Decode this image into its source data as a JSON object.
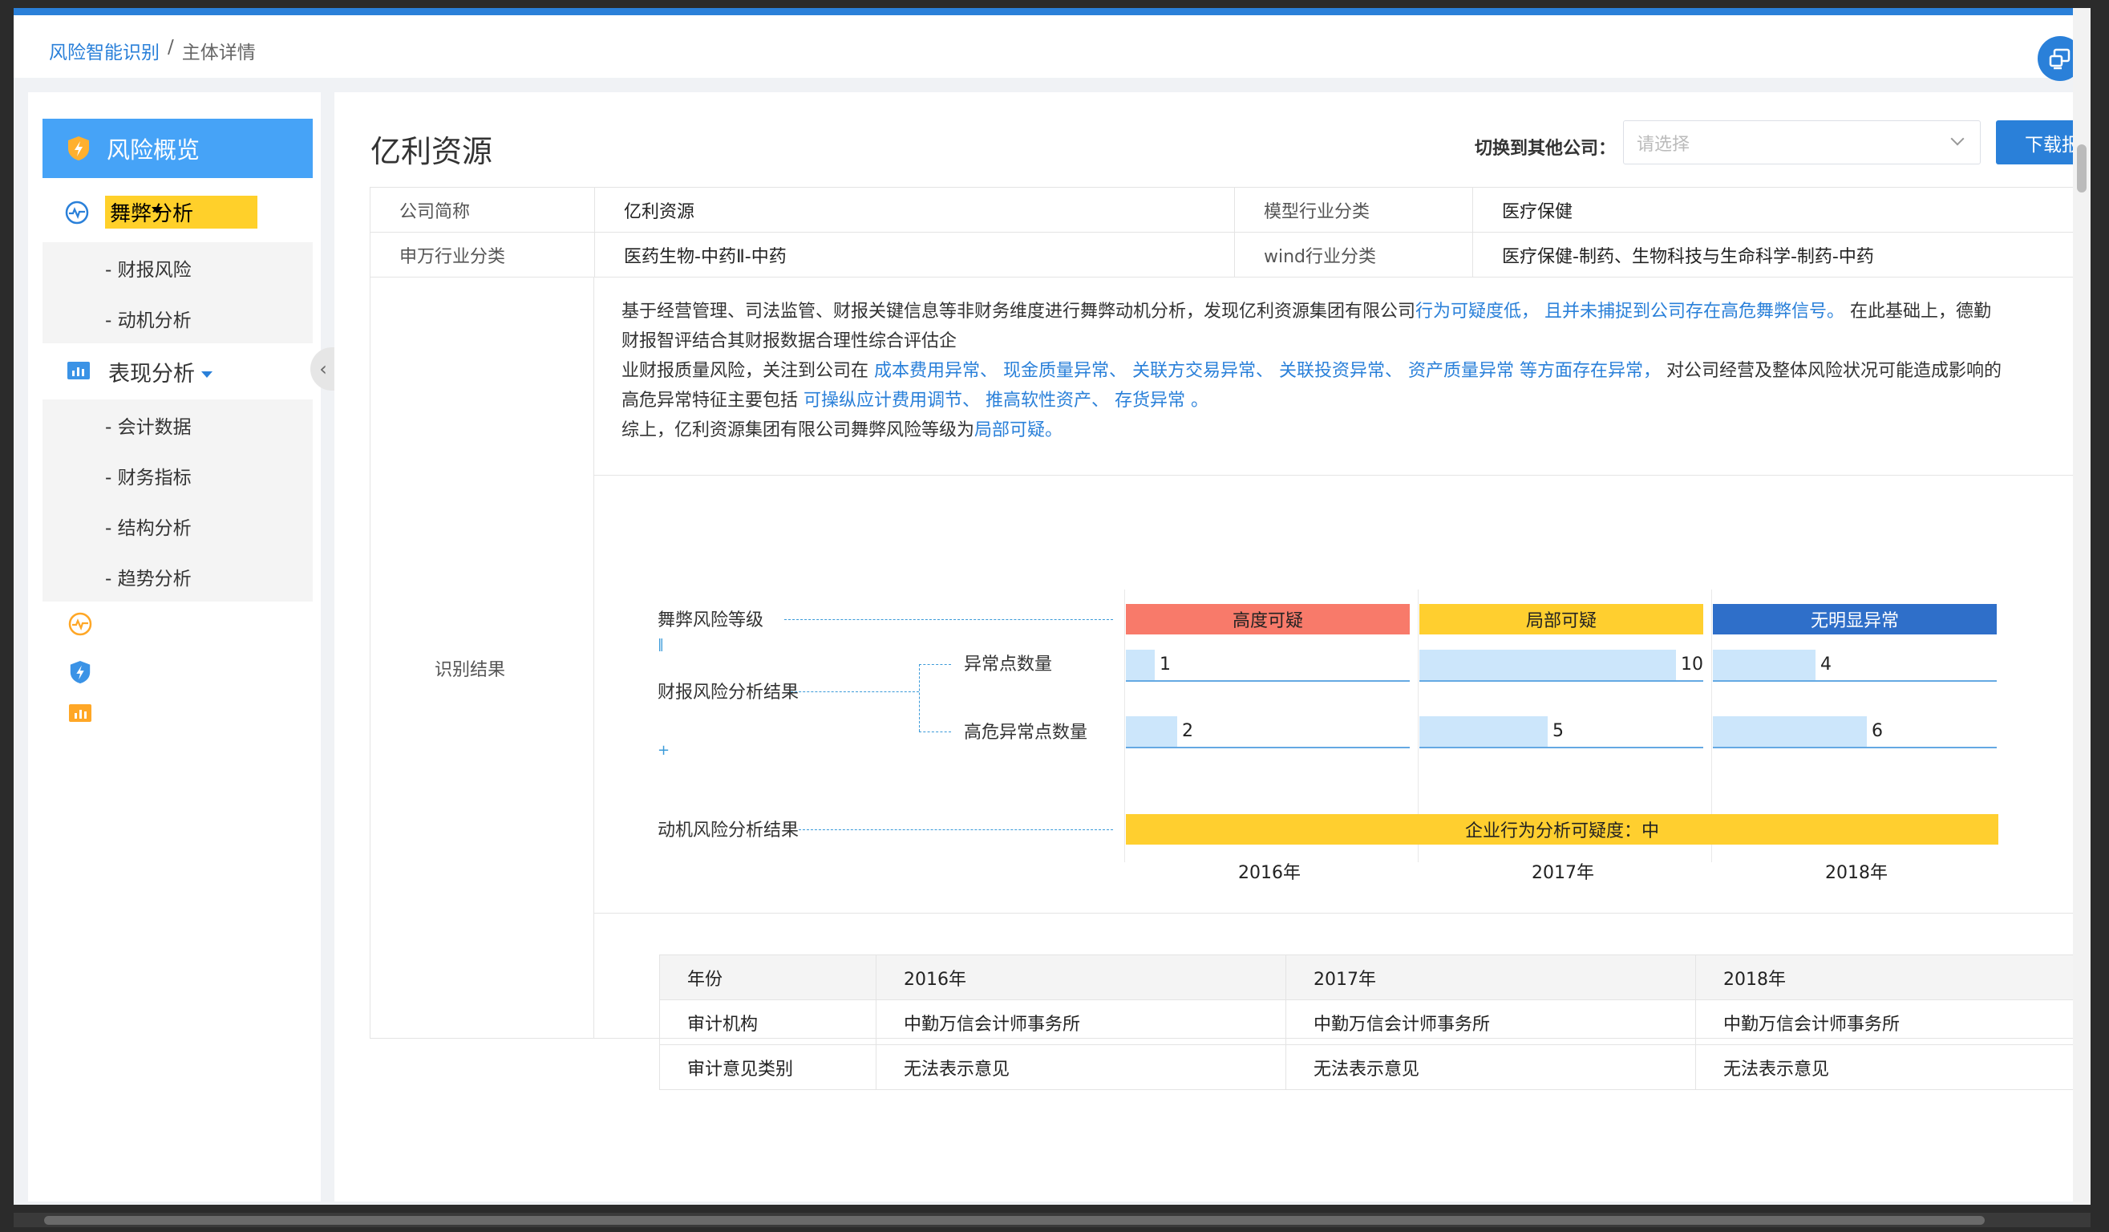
{
  "breadcrumb": {
    "root": "风险智能识别",
    "sep": "/",
    "current": "主体详情"
  },
  "sidebar": {
    "overview": "风险概览",
    "fraud": "舞弊分析",
    "fraud_items": [
      "- 财报风险",
      "- 动机分析"
    ],
    "perf": "表现分析",
    "perf_items": [
      "- 会计数据",
      "- 财务指标",
      "- 结构分析",
      "- 趋势分析"
    ],
    "collapse_glyph": "‹"
  },
  "header": {
    "company": "亿利资源",
    "switch_label": "切换到其他公司：",
    "select_placeholder": "请选择",
    "download": "下载报告"
  },
  "info": {
    "short_name_k": "公司简称",
    "short_name_v": "亿利资源",
    "model_k": "模型行业分类",
    "model_v": "医疗保健",
    "sw_k": "申万行业分类",
    "sw_v": "医药生物-中药Ⅱ-中药",
    "wind_k": "wind行业分类",
    "wind_v": "医疗保健-制药、生物科技与生命科学-制药-中药",
    "result_k": "识别结果"
  },
  "desc": {
    "l1a": "基于经营管理、司法监管、财报关键信息等非财务维度进行舞弊动机分析，发现亿利资源集团有限公司",
    "l1b": "行为可疑度低，",
    "l1c": "且并未捕捉到公司存在高危舞弊信号。",
    "l1d": " 在此基础上，德勤",
    "l2": "财报智评结合其财报数据合理性综合评估企",
    "l3a": "业财报质量风险，关注到公司在",
    "l3b": "成本费用异常、 现金质量异常、 关联方交易异常、 关联投资异常、 资产质量异常 等方面存在异常，",
    "l3c": " 对公司经营及整体风险状况可能造成影响的",
    "l4a": "高危异常特征主要包括",
    "l4b": "可操纵应计费用调节、 推高软性资产、 存货异常 。",
    "l5a": "综上，亿利资源集团有限公司舞弊风险等级为",
    "l5b": "局部可疑",
    "l5c": "。"
  },
  "diagram": {
    "level_label": "舞弊风险等级",
    "report_label": "财报风险分析结果",
    "abn_label": "异常点数量",
    "high_label": "高危异常点数量",
    "motive_label": "动机风险分析结果",
    "collapse_mark": "‖",
    "expand_mark": "+",
    "levels": [
      "高度可疑",
      "局部可疑",
      "无明显异常"
    ],
    "level_colors": [
      "#f87a6a",
      "#ffcf2f",
      "#2f6fc9"
    ],
    "abnormal_counts": [
      1,
      10,
      4
    ],
    "high_counts": [
      2,
      5,
      6
    ],
    "motive_text": "企业行为分析可疑度：中",
    "years": [
      "2016年",
      "2017年",
      "2018年"
    ]
  },
  "audit": {
    "headers": [
      "年份",
      "2016年",
      "2017年",
      "2018年"
    ],
    "row1_label": "审计机构",
    "row1": [
      "中勤万信会计师事务所",
      "中勤万信会计师事务所",
      "中勤万信会计师事务所"
    ],
    "row2_label": "审计意见类别",
    "row2": [
      "无法表示意见",
      "无法表示意见",
      "无法表示意见"
    ]
  }
}
